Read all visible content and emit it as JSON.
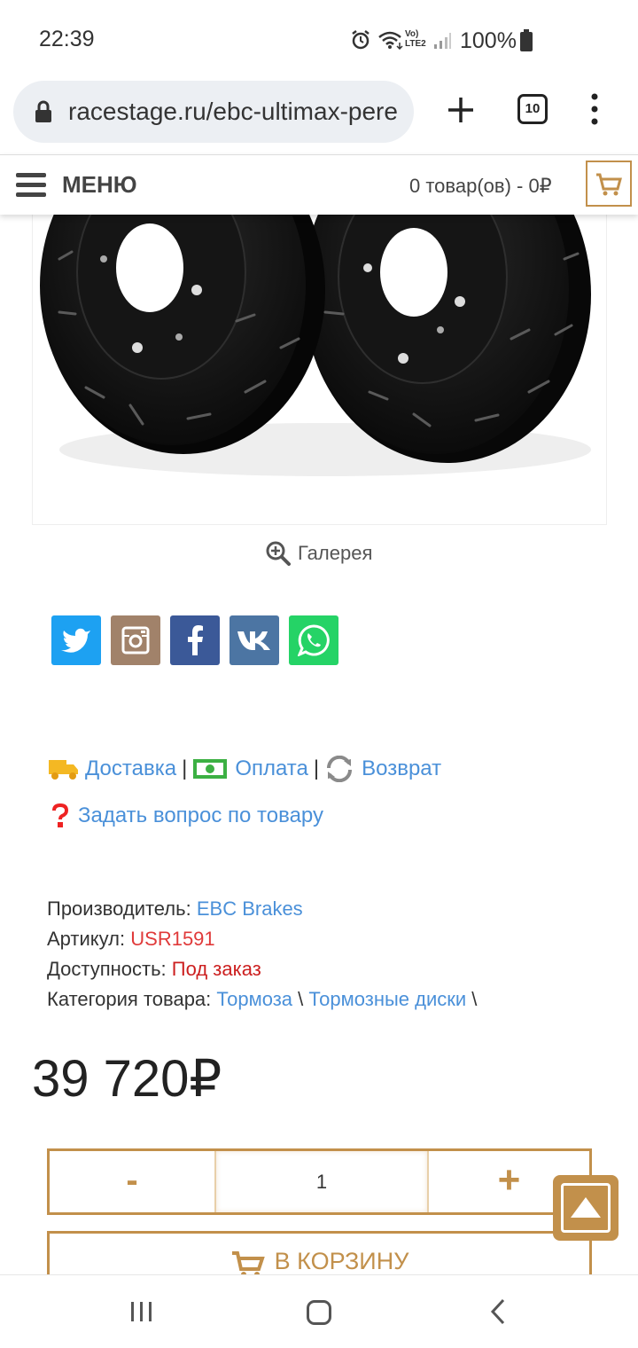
{
  "status_bar": {
    "time": "22:39",
    "volte_label": "Vo) LTE2",
    "battery": "100%",
    "icons": [
      "alarm-icon",
      "wifi-icon",
      "signal-icon",
      "battery-icon"
    ]
  },
  "browser": {
    "url": "racestage.ru/ebc-ultimax-pere",
    "tabs_count": "10",
    "icons": [
      "lock-icon",
      "plus-icon",
      "more-vert-icon"
    ]
  },
  "header": {
    "menu_label": "МЕНЮ",
    "cart_summary": "0 товар(ов) - 0₽"
  },
  "product": {
    "gallery_label": "Галерея",
    "info_links": {
      "delivery": "Доставка",
      "payment": "Оплата",
      "returns": "Возврат",
      "separator": "|"
    },
    "ask_question": "Задать вопрос по товару",
    "specs": {
      "manufacturer_label": "Производитель:",
      "manufacturer_value": "EBC Brakes",
      "sku_label": "Артикул:",
      "sku_value": "USR1591",
      "availability_label": "Доступность:",
      "availability_value": "Под заказ",
      "category_label": "Категория товара:",
      "category_1": "Тормоза",
      "category_2": "Тормозные диски",
      "category_sep": "\\"
    },
    "price": "39 720₽",
    "quantity": {
      "minus": "-",
      "value": "1",
      "plus": "+"
    },
    "add_to_cart": "В КОРЗИНУ"
  },
  "social": [
    "twitter",
    "instagram",
    "facebook",
    "vk",
    "whatsapp"
  ],
  "colors": {
    "accent": "#c2904b",
    "link": "#4a90d9",
    "sku": "#e03a3a",
    "availability": "#cc1f1f",
    "twitter": "#1da1f2",
    "instagram": "#a1826a",
    "facebook": "#3b5998",
    "vk": "#4c75a3",
    "whatsapp": "#25d366"
  }
}
